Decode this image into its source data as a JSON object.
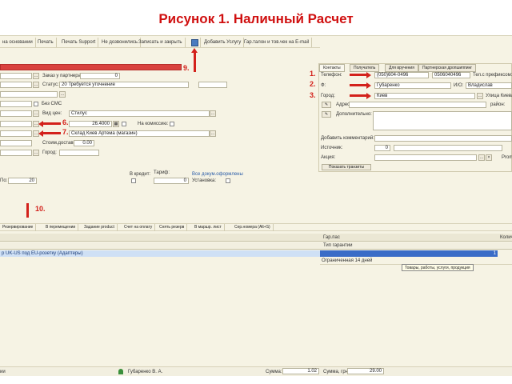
{
  "slide_title": "Рисунок 1. Наличный Расчет",
  "toolbar": {
    "items": [
      "на основании",
      "Печать",
      "Печать Support",
      "Не дозвонились",
      "Записать и закрыть",
      "Добавить Услугу",
      "Гар.талон и тов.чек на E-mail"
    ]
  },
  "left_form": {
    "order_partner_label": "Заказ у партнера:",
    "order_partner_value": "0",
    "status_label": "Статус:",
    "status_value": "20 Требуется уточнение",
    "no_sms_label": "Без СМС",
    "price_type_label": "Вид цен:",
    "price_type_value": "Стилус",
    "rate_value": "26.4000",
    "commission_label": "На комиссию:",
    "warehouse_value": "Склад Киев Артема (магазин)",
    "delivery_cost_label": "Стоим.доставки:",
    "delivery_cost_value": "0.00",
    "city_label": "Город:",
    "po_label": "По:",
    "po_value": "20",
    "credit_label": "В кредит:",
    "tariff_label": "Тариф:",
    "tariff_value": "0",
    "docs_label": "Все докум.оформлены",
    "installation_label": "Установка:"
  },
  "annotations": {
    "n1": "1.",
    "n2": "2.",
    "n3": "3.",
    "n6": "6.",
    "n7": "7.",
    "n9": "9.",
    "n10": "10."
  },
  "right_panel": {
    "tabs": [
      "Контакты",
      "Получатель",
      "Для вручения",
      "Партнерская дропшиппинг"
    ],
    "phone_label": "Телефон:",
    "phone_value": "(050)604-0496",
    "phone_value2": "0506040496",
    "phone_prefix_label": "Тел.с префиксом:",
    "surname_label": "Ф:",
    "surname_value": "Губаренко",
    "name_label": "И/О:",
    "name_value": "Владислав",
    "city_label": "Город:",
    "city_value": "Киев",
    "street_value": "Улица Киева",
    "address_label": "Адрес:",
    "district_label": "район:",
    "additional_label": "Дополнительно:",
    "add_comment_label": "Добавить комментарий:",
    "source_label": "Источник:",
    "source_value": "0",
    "promo_label": "Акция:",
    "promo_right": "Promo",
    "show_transit_button": "Показать транзиты"
  },
  "lower_tabs": [
    "Резервирование",
    "В перемещении",
    "Задание product",
    "Счет на оплату",
    "Снять резерв",
    "В маршр. лист",
    "Сер.номера (Alt+S)"
  ],
  "grid": {
    "col_garpas": "Гар.пас",
    "col_qty": "Количество",
    "col_garanty_type": "Тип гарантии",
    "row_item": "р UK-US под EU-розетку (Адаптеры)",
    "row_qty": "1",
    "row_guarantee": "Ограниченная 14 дней",
    "tooltip": "Товары, работы, услуги, продукция"
  },
  "statusbar": {
    "left": "ии",
    "manager": "Губаренко В. А.",
    "sum_label": "Сумма:",
    "sum_value": "1.02",
    "sum_uah_label": "Сумма, грн:",
    "sum_uah_value": "29.00"
  }
}
